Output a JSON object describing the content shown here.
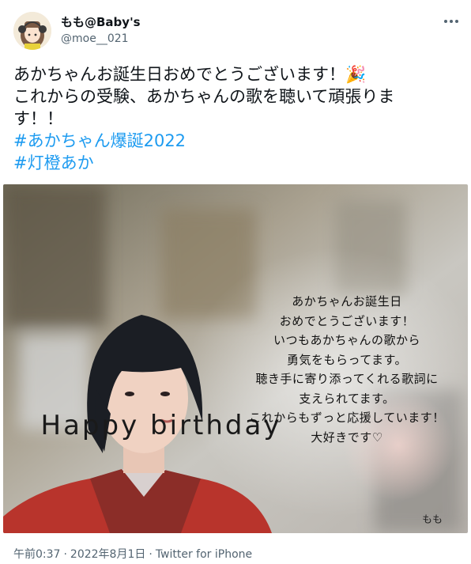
{
  "author": {
    "display_name": "もも@Baby's",
    "handle": "@moe__021"
  },
  "tweet": {
    "lines": [
      "あかちゃんお誕生日おめでとうございます！🎉",
      "これからの受験、あかちゃんの歌を聴いて頑張りま",
      "す！！"
    ],
    "hashtags": [
      "#あかちゃん爆誕2022",
      "#灯橙あか"
    ]
  },
  "image": {
    "title": "Happy birthday",
    "message": [
      "あかちゃんお誕生日",
      "おめでとうございます！",
      "いつもあかちゃんの歌から",
      "勇気をもらってます。",
      "聴き手に寄り添ってくれる歌詞に",
      "支えられてます。",
      "これからもずっと応援しています！",
      "大好きです♡"
    ],
    "signature": "もも"
  },
  "meta": {
    "time": "午前0:37",
    "date": "2022年8月1日",
    "source": "Twitter for iPhone",
    "separator": "·"
  },
  "icons": {
    "more": "more-options-icon",
    "avatar": "avatar-image"
  },
  "colors": {
    "link": "#1d9bf0",
    "secondary_text": "#536471",
    "primary_text": "#0f1419"
  }
}
